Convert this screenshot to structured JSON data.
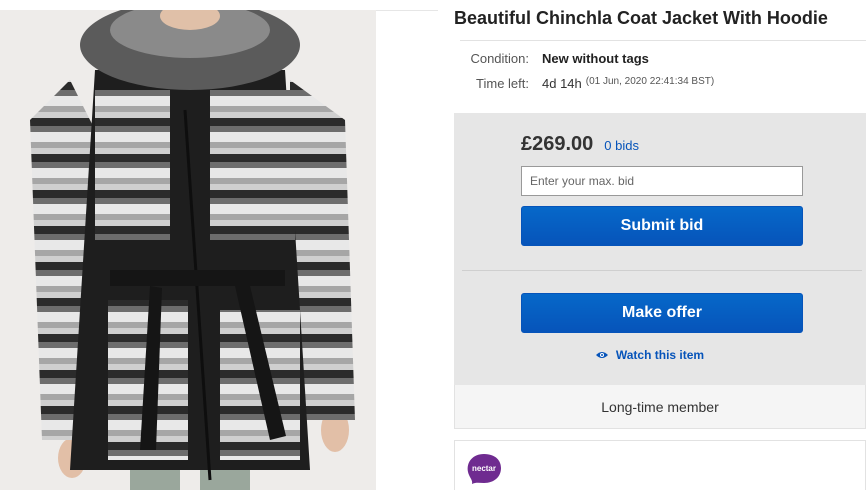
{
  "listing": {
    "title": "Beautiful Chinchla Coat Jacket With Hoodie",
    "condition_label": "Condition:",
    "condition_value": "New without tags",
    "time_left_label": "Time left:",
    "time_left_value": "4d 14h",
    "time_left_detail": "(01 Jun, 2020  22:41:34 BST)"
  },
  "bid": {
    "price": "£269.00",
    "bids_link": "0 bids",
    "input_placeholder": "Enter your max. bid",
    "submit_label": "Submit bid",
    "offer_label": "Make offer",
    "watch_label": "Watch this item"
  },
  "seller": {
    "badge": "Long-time member"
  },
  "nectar": {
    "logo_text": "nectar"
  },
  "colors": {
    "accent_blue": "#0654ba",
    "panel_gray": "#e6e6e6",
    "nectar_purple": "#6f2b90"
  },
  "icons": {
    "watch": "eye-icon",
    "nectar": "nectar-logo"
  }
}
